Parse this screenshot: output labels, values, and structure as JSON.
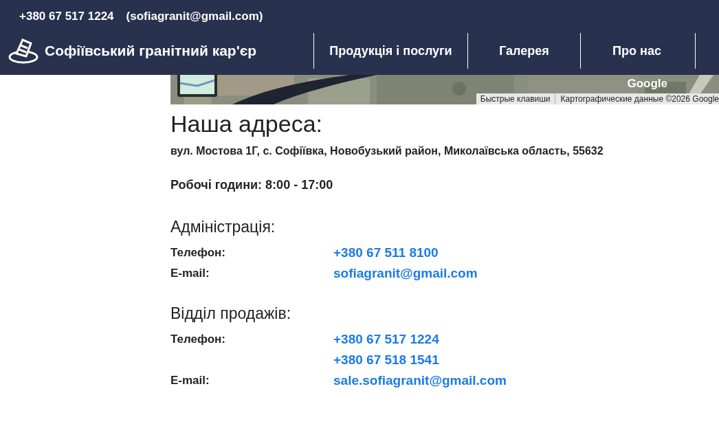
{
  "top_bar": {
    "phone": "+380 67 517 1224",
    "email": "(sofiagranit@gmail.com)"
  },
  "header": {
    "logo_text": "Софіївський гранітний кар'єр",
    "nav": [
      {
        "label": "Продукція і послуги"
      },
      {
        "label": "Галерея"
      },
      {
        "label": "Про нас"
      }
    ]
  },
  "map": {
    "kind": "picture",
    "logo": "Google",
    "shortcuts": "Быстрые клавиши",
    "attribution": "Картографические данные ©2026 Google"
  },
  "address": {
    "title": "Наша адреса:",
    "text": "вул. Мостова 1Г, с. Софіївка, Новобузький район, Миколаївська область, 55632",
    "hours": "Робочі години: 8:00 - 17:00"
  },
  "sections": [
    {
      "title": "Адміністрація:",
      "rows": [
        {
          "label": "Телефон:",
          "values": [
            "+380 67 511 8100"
          ]
        },
        {
          "label": "E-mail:",
          "values": [
            "sofiagranit@gmail.com"
          ]
        }
      ]
    },
    {
      "title": "Відділ продажів:",
      "rows": [
        {
          "label": "Телефон:",
          "values": [
            "+380 67 517 1224",
            "+380 67 518 1541"
          ]
        },
        {
          "label": "E-mail:",
          "values": [
            "sale.sofiagranit@gmail.com"
          ]
        }
      ]
    }
  ]
}
